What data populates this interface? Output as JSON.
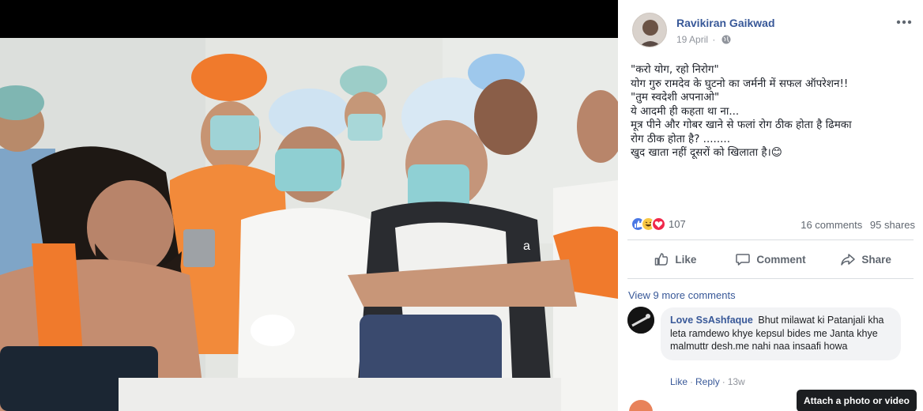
{
  "post": {
    "author": "Ravikiran Gaikwad",
    "date": "19 April",
    "privacy_icon": "globe-icon",
    "text_lines": [
      "\"करो योग, रहो निरोग\"",
      "योग गुरु रामदेव के घुटनो का जर्मनी में सफल ऑपरेशन!!",
      "\"तुम स्वदेशी अपनाओ\"",
      "ये आदमी ही कहता था ना...",
      "मूत्र पीने और गोबर खाने से फलां रोग ठीक होता है ढिमका",
      "रोग ठीक होता है? ........",
      "खुद खाता नहीं दूसरों को खिलाता है।"
    ],
    "emoji": "😊",
    "reaction_count": "107",
    "comments_count": "16 comments",
    "shares_count": "95 shares"
  },
  "actions": {
    "like": "Like",
    "comment": "Comment",
    "share": "Share"
  },
  "view_more": "View 9 more comments",
  "comment": {
    "author": "Love SsAshfaque",
    "text": "Bhut milawat ki Patanjali kha leta ramdewo khye kepsul bides me Janta khye malmuttr desh.me nahi naa insaafi howa",
    "like": "Like",
    "reply": "Reply",
    "time": "13w"
  },
  "tooltip": "Attach a photo or video",
  "photo": {
    "watermark": "a"
  },
  "colors": {
    "link": "#385898",
    "secondary": "#606770",
    "saffron": "#f07a2c"
  }
}
